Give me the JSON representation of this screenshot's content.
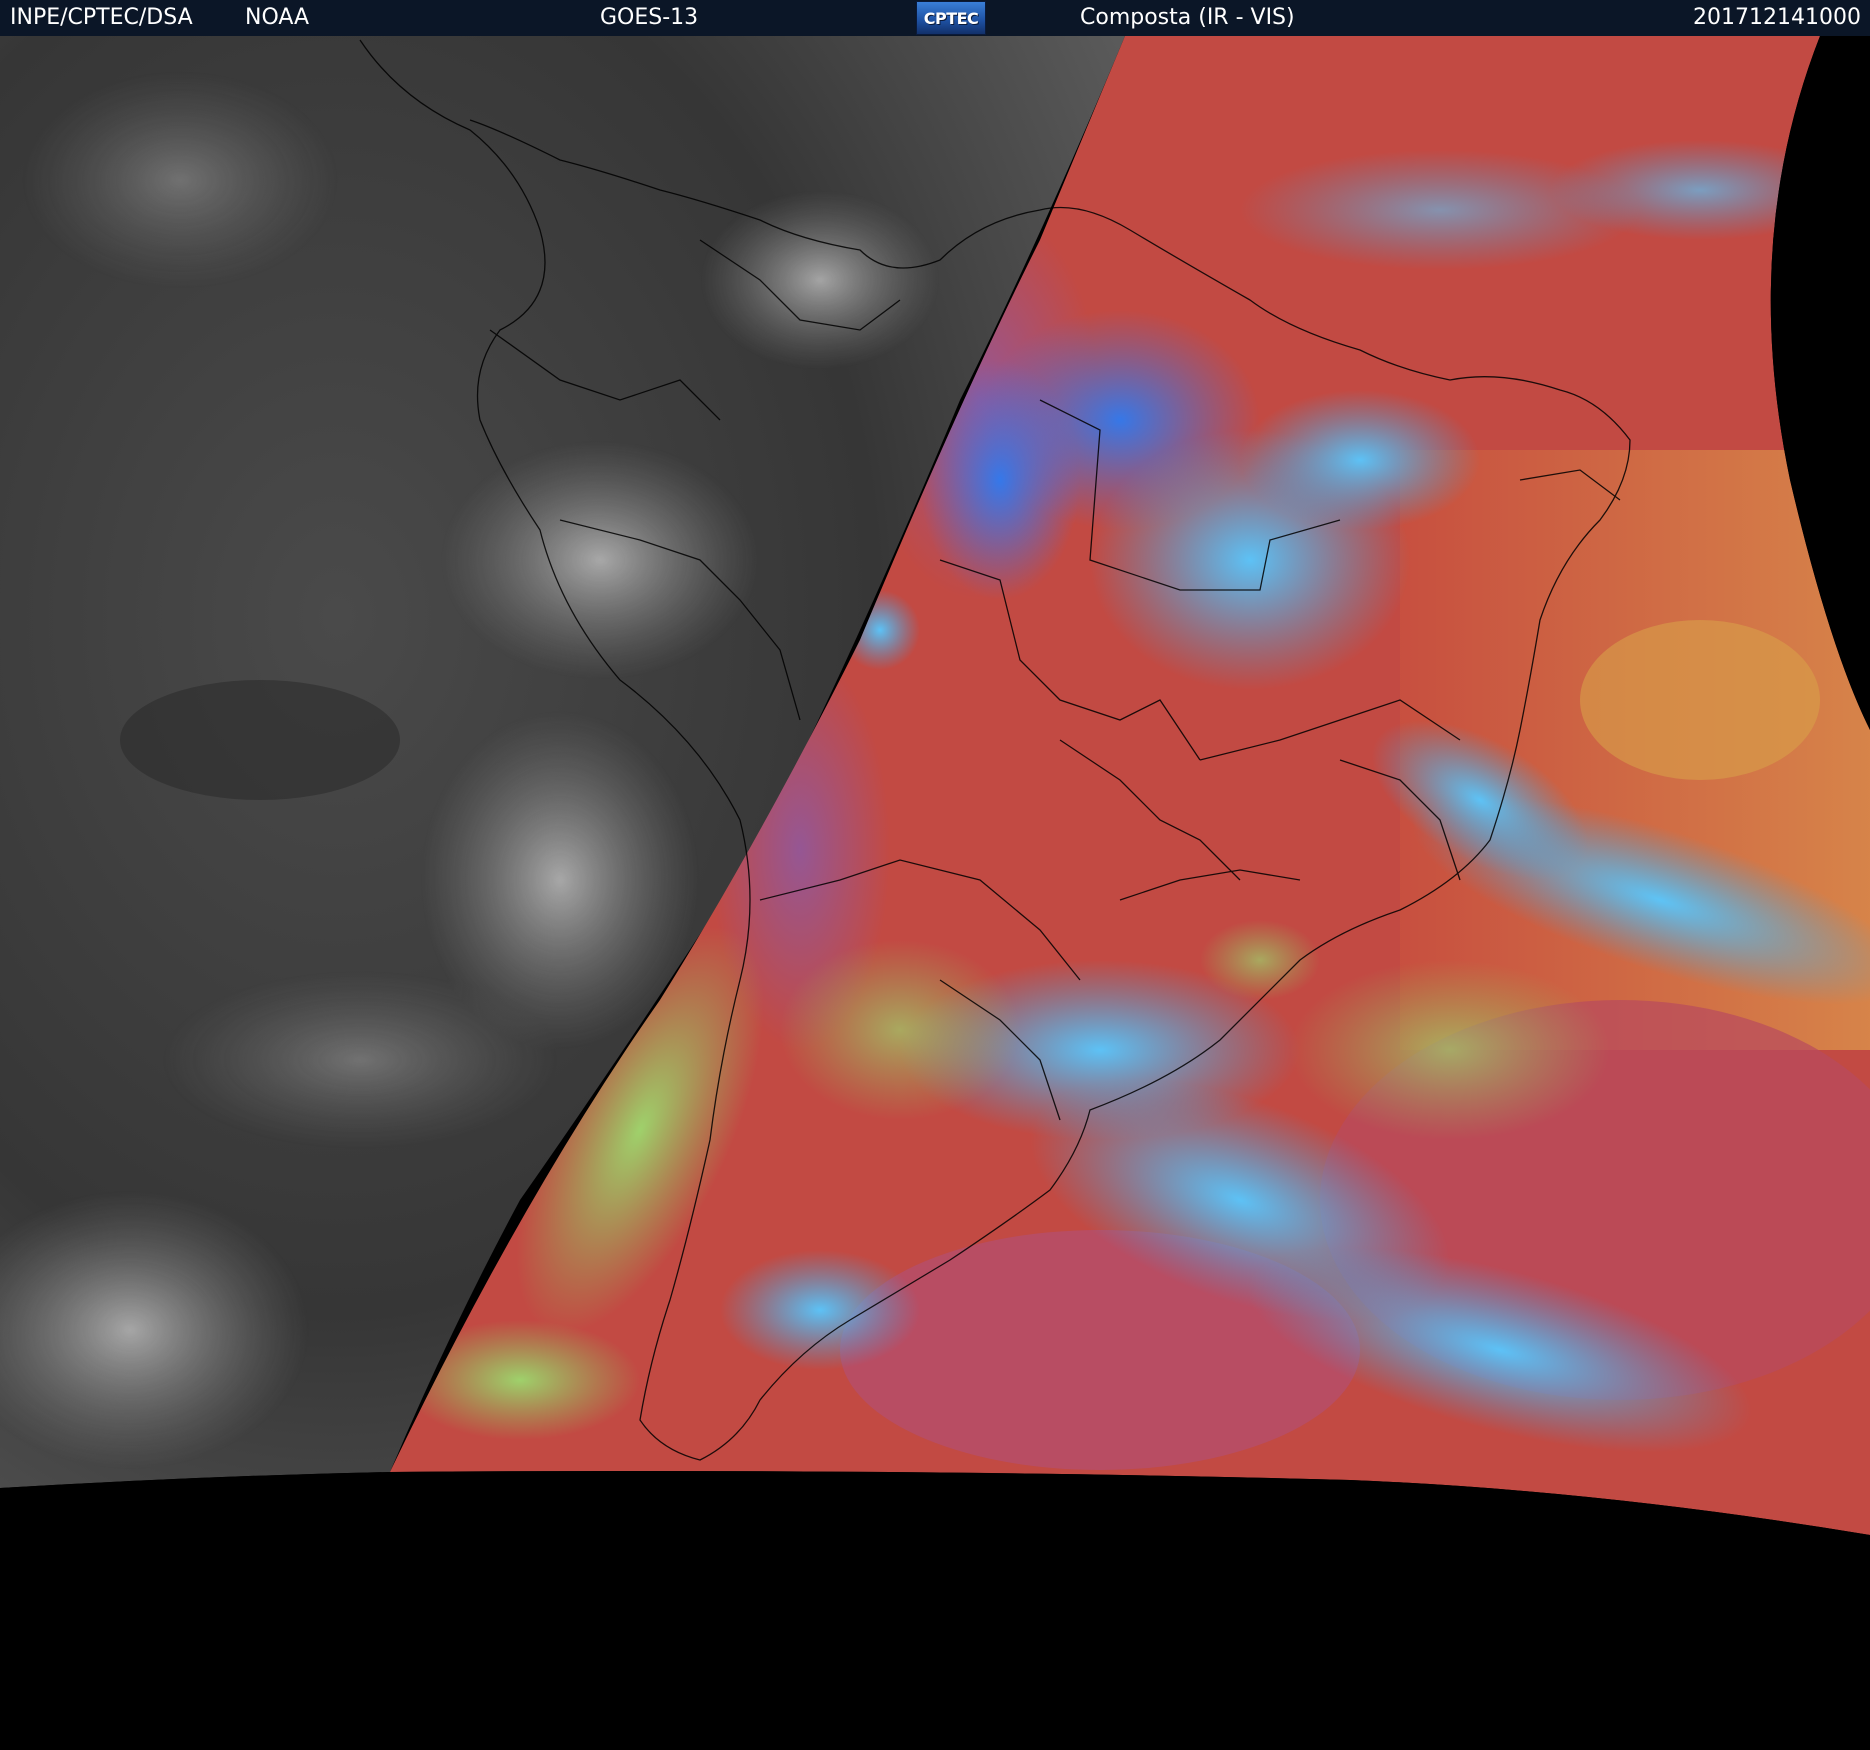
{
  "header": {
    "left_org": "INPE/CPTEC/DSA",
    "left_agency": "NOAA",
    "satellite": "GOES-13",
    "logo_text": "CPTEC",
    "product": "Composta (IR - VIS)",
    "timestamp": "201712141000"
  },
  "colors": {
    "header_bg": "#0b1627",
    "night_gray": "#3b3b3b",
    "day_red": "#c24a43",
    "cloud_cyan": "#3fb8f0",
    "cloud_blue": "#2e7be8",
    "cloud_green": "#8edc6a",
    "ocean_orange": "#d9814a",
    "space": "#000000",
    "border_line": "#000000"
  }
}
